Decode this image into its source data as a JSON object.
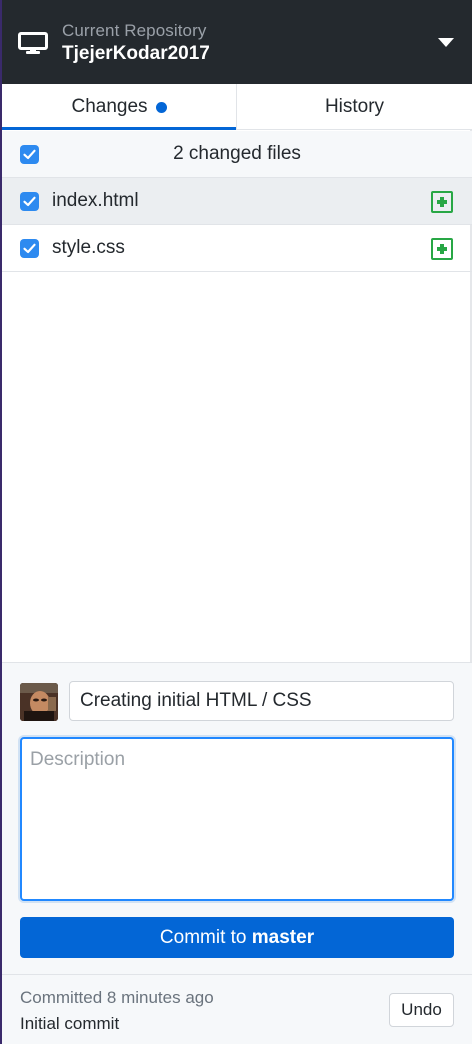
{
  "toolbar": {
    "caption": "Current Repository",
    "repo_name": "TjejerKodar2017",
    "icon": "monitor-icon",
    "dropdown_icon": "caret-down-icon"
  },
  "tabs": [
    {
      "label": "Changes",
      "active": true,
      "has_indicator": true
    },
    {
      "label": "History",
      "active": false
    }
  ],
  "changes": {
    "header": "2 changed files",
    "all_checked": true,
    "files": [
      {
        "name": "index.html",
        "checked": true,
        "status": "added",
        "selected": true
      },
      {
        "name": "style.css",
        "checked": true,
        "status": "added",
        "selected": false
      }
    ]
  },
  "commit": {
    "summary_value": "Creating initial HTML / CSS",
    "description_placeholder": "Description",
    "button_prefix": "Commit to",
    "branch": "master"
  },
  "last_commit": {
    "when": "Committed 8 minutes ago",
    "message": "Initial commit",
    "undo_label": "Undo"
  },
  "colors": {
    "toolbar_bg": "#24292e",
    "accent": "#0366d6",
    "added_green": "#28a745",
    "checkbox_blue": "#2d8af0"
  }
}
